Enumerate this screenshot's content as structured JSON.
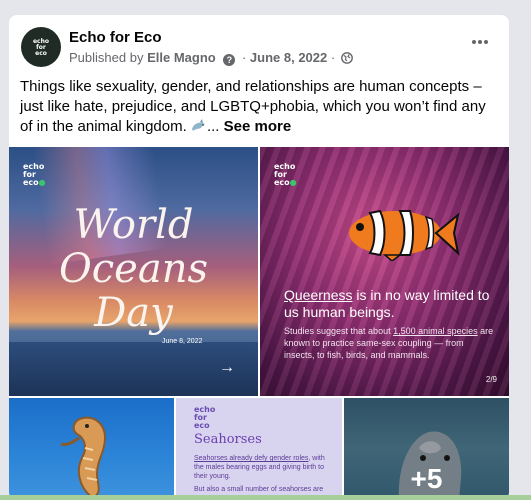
{
  "post": {
    "page_name": "Echo for Eco",
    "avatar_text": "echo for eco",
    "published_by_label": "Published by",
    "author": "Elle Magno",
    "info_icon": "?",
    "separator": "·",
    "date": "June 8, 2022",
    "text": "Things like sexuality, gender, and relationships are human concepts – just like hate, prejudice, and LGBTQ+phobia, which you won’t find any of in the animal kingdom.",
    "ellipsis": "...",
    "see_more": "See more",
    "icons": {
      "more": "more-options-icon",
      "globe": "globe-icon",
      "emoji": "dolphin-emoji"
    }
  },
  "photos": {
    "logo_lines": [
      "echo",
      "for",
      "eco"
    ],
    "p1": {
      "title_lines": [
        "World",
        "Oceans",
        "Day"
      ],
      "date": "June 8, 2022",
      "arrow": "→"
    },
    "p2": {
      "headline_emph": "Queerness",
      "headline_rest": " is in no way limited to us human beings.",
      "body_pre": "Studies suggest that about ",
      "body_link": "1,500 animal species",
      "body_post": " are known to practice same-sex coupling — from insects, to fish, birds, and mammals.",
      "page": "2/9"
    },
    "p4": {
      "title": "Seahorses",
      "text_link": "Seahorses already defy gender roles",
      "text_rest": ", with the males bearing eggs and giving birth to their young.",
      "text2": "But also a small number of seahorses are"
    },
    "p5": {
      "more_count": "+5"
    }
  },
  "colors": {
    "accent_green": "#3cc46b",
    "secondary_text": "#65676b"
  }
}
